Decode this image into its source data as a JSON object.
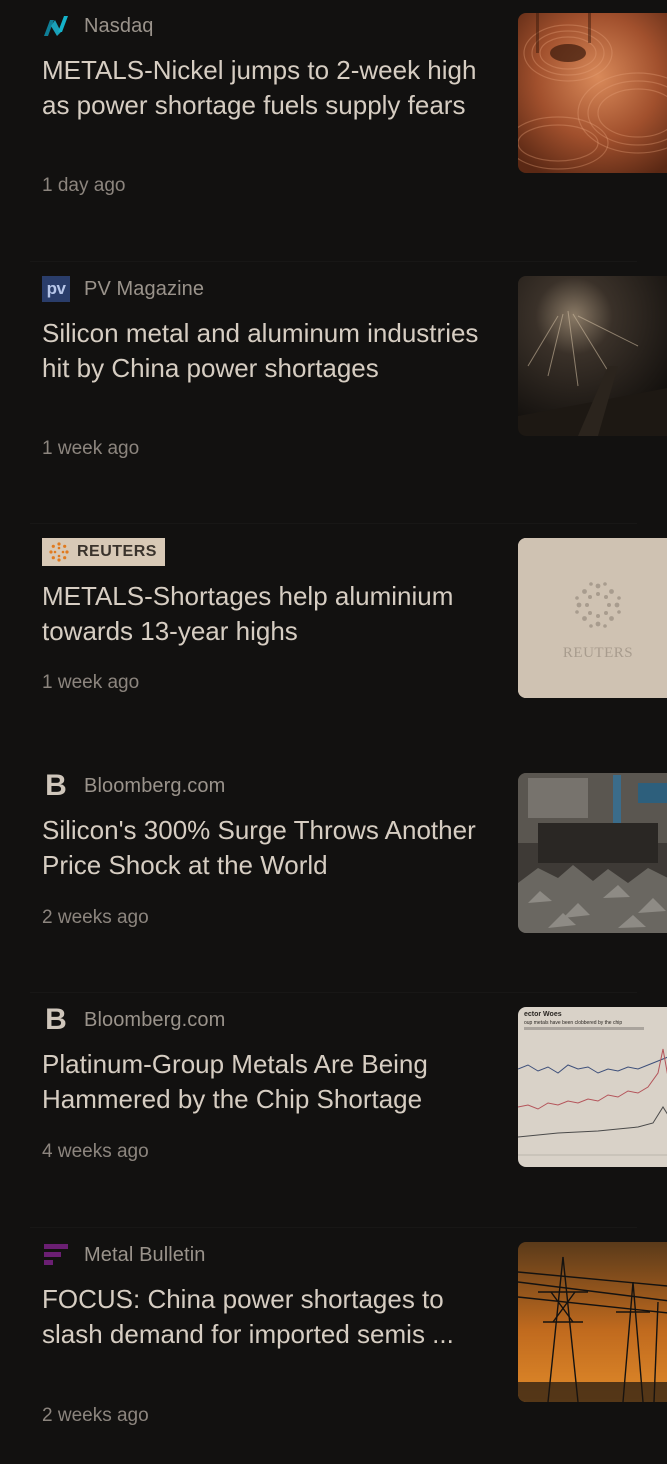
{
  "articles": [
    {
      "source": "Nasdaq",
      "source_icon": "nasdaq-logo-icon",
      "headline": "METALS-Nickel jumps to 2-week high as power shortage fuels supply fears",
      "time": "1 day ago",
      "thumbnail": "copper-coils-image"
    },
    {
      "source": "PV Magazine",
      "source_icon": "pv-magazine-logo-icon",
      "logo_text": "pv",
      "headline": "Silicon metal and aluminum industries hit by China power shortages",
      "time": "1 week ago",
      "thumbnail": "mine-interior-image"
    },
    {
      "source": "REUTERS",
      "source_icon": "reuters-logo-icon",
      "headline": "METALS-Shortages help aluminium towards 13-year highs",
      "time": "1 week ago",
      "thumbnail": "reuters-placeholder-image",
      "thumb_label": "REUTERS"
    },
    {
      "source": "Bloomberg.com",
      "source_icon": "bloomberg-logo-icon",
      "logo_text": "B",
      "headline": "Silicon's 300% Surge Throws Another Price Shock at the World",
      "time": "2 weeks ago",
      "thumbnail": "silicon-factory-image"
    },
    {
      "source": "Bloomberg.com",
      "source_icon": "bloomberg-logo-icon",
      "logo_text": "B",
      "headline": "Platinum-Group Metals Are Being Hammered by the Chip Shortage",
      "time": "4 weeks ago",
      "thumbnail": "price-chart-image",
      "thumb_title": "ector Woes",
      "thumb_subtitle": "oup metals have been clobbered by the chip"
    },
    {
      "source": "Metal Bulletin",
      "source_icon": "metal-bulletin-logo-icon",
      "headline": "FOCUS: China power shortages to slash demand for imported semis ...",
      "time": "2 weeks ago",
      "thumbnail": "power-lines-image"
    }
  ],
  "colors": {
    "background": "#121110",
    "headline": "#d6cdc2",
    "source_text": "#9a938b",
    "time_text": "#8c857e",
    "nasdaq_accent": "#1aa0b8",
    "metal_bulletin_accent": "#6b1f73",
    "reuters_badge": "#d8c9b6"
  }
}
